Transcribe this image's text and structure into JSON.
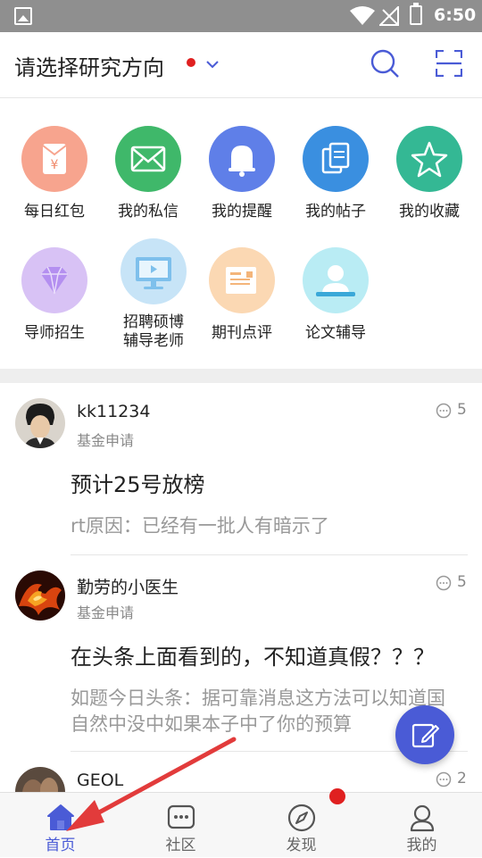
{
  "status_bar": {
    "time": "6:50"
  },
  "header": {
    "title": "请选择研究方向",
    "icons": [
      "chevron-down-icon",
      "search-icon",
      "scan-icon"
    ],
    "accent": "#4a5bd6"
  },
  "grid": {
    "items": [
      {
        "label": "每日红包",
        "icon": "red-envelope-icon",
        "color": "#f7a48e"
      },
      {
        "label": "我的私信",
        "icon": "mail-icon",
        "color": "#3fb86a"
      },
      {
        "label": "我的提醒",
        "icon": "bell-icon",
        "color": "#5f7fe8"
      },
      {
        "label": "我的帖子",
        "icon": "copy-icon",
        "color": "#3a8fe0"
      },
      {
        "label": "我的收藏",
        "icon": "star-icon",
        "color": "#34b894"
      },
      {
        "label": "导师招生",
        "icon": "diamond-icon",
        "color": "#d8c2f5"
      },
      {
        "label_line1": "招聘硕博",
        "label_line2": "辅导老师",
        "icon": "monitor-icon",
        "color": "#c7e4f7"
      },
      {
        "label": "期刊点评",
        "icon": "envelope-letter-icon",
        "color": "#fbd8b3"
      },
      {
        "label": "论文辅导",
        "icon": "tutor-icon",
        "color": "#b9ecf4"
      }
    ]
  },
  "posts": [
    {
      "user": "kk11234",
      "category": "基金申请",
      "count": "5",
      "title": "预计25号放榜",
      "body": "rt原因：已经有一批人有暗示了"
    },
    {
      "user": "勤劳的小医生",
      "category": "基金申请",
      "count": "5",
      "title": "在头条上面看到的，不知道真假？？？",
      "body": "如题今日头条：据可靠消息这方法可以知道国自然中没中如果本子中了你的预算"
    },
    {
      "user": "GEOL",
      "category": "",
      "count": "2",
      "title": "",
      "body": ""
    }
  ],
  "bottom_nav": {
    "tabs": [
      {
        "label": "首页",
        "icon": "home-icon",
        "active": true
      },
      {
        "label": "社区",
        "icon": "community-icon",
        "active": false
      },
      {
        "label": "发现",
        "icon": "compass-icon",
        "active": false
      },
      {
        "label": "我的",
        "icon": "person-icon",
        "active": false
      }
    ]
  },
  "fab": {
    "icon": "edit-icon"
  },
  "colors": {
    "notify_dot": "#e02020",
    "annotation_arrow": "#e23b3b"
  }
}
